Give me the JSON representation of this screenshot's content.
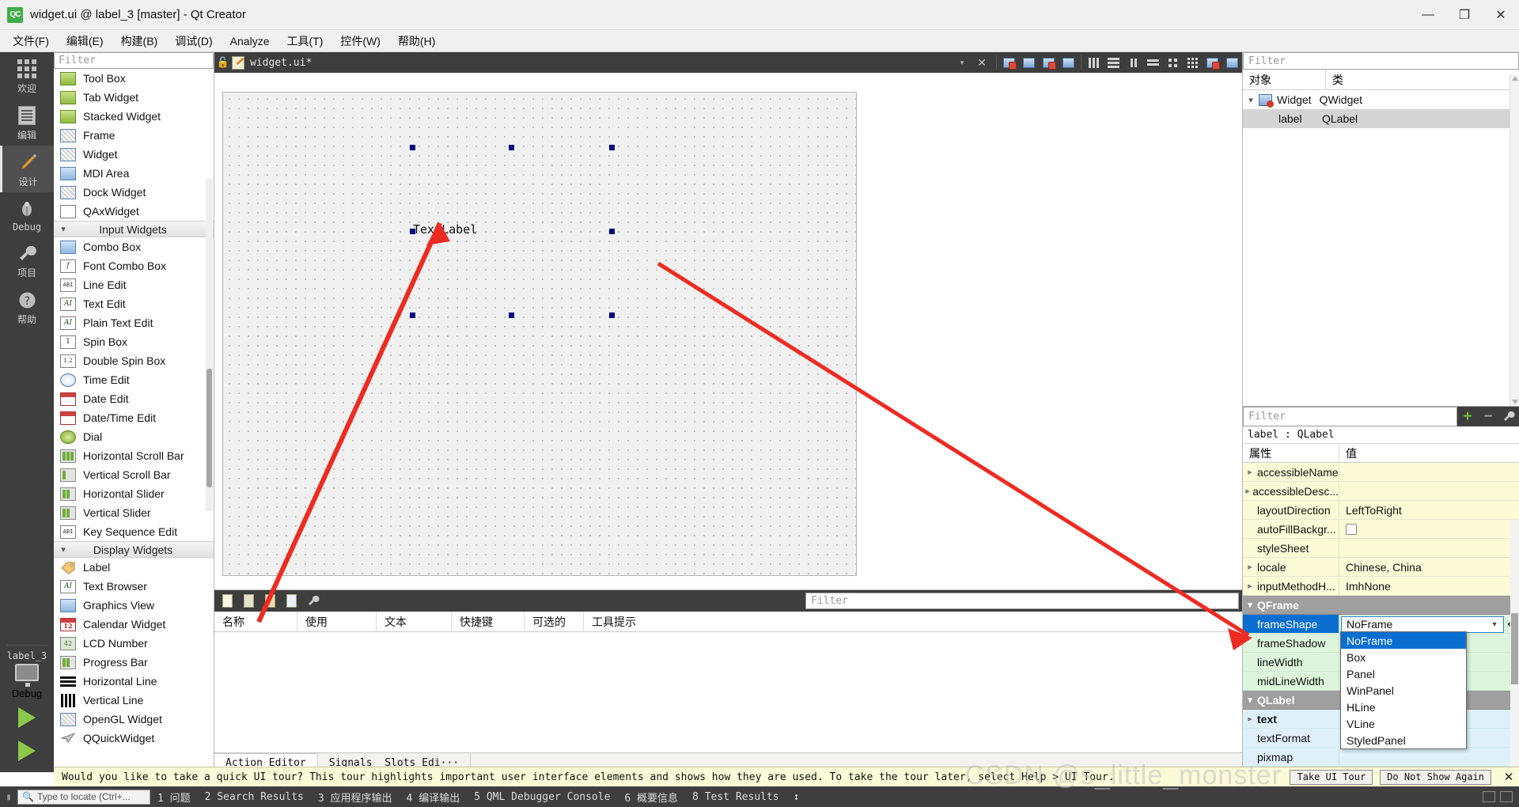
{
  "window": {
    "title": "widget.ui @ label_3 [master] - Qt Creator",
    "app_badge": "QC",
    "minimize": "—",
    "restore": "❐",
    "close": "✕"
  },
  "menubar": {
    "items": [
      {
        "label": "文件(F)"
      },
      {
        "label": "编辑(E)"
      },
      {
        "label": "构建(B)"
      },
      {
        "label": "调试(D)"
      },
      {
        "label": "Analyze"
      },
      {
        "label": "工具(T)"
      },
      {
        "label": "控件(W)"
      },
      {
        "label": "帮助(H)"
      }
    ]
  },
  "activity_bar": {
    "items": [
      {
        "label": "欢迎",
        "icon": "grid-icon",
        "selected": false
      },
      {
        "label": "编辑",
        "icon": "document-icon",
        "selected": false
      },
      {
        "label": "设计",
        "icon": "pencil-icon",
        "selected": true
      },
      {
        "label": "Debug",
        "icon": "bug-icon",
        "selected": false
      },
      {
        "label": "项目",
        "icon": "wrench-icon",
        "selected": false
      },
      {
        "label": "帮助",
        "icon": "question-icon",
        "selected": false
      }
    ],
    "kit_name": "label_3",
    "run_config_label": "Debug"
  },
  "widget_box": {
    "filter_placeholder": "Filter",
    "items": [
      {
        "label": "Tool Box",
        "icon": "toolbox-icon",
        "style": "green"
      },
      {
        "label": "Tab Widget",
        "icon": "tabwidget-icon",
        "style": "green"
      },
      {
        "label": "Stacked Widget",
        "icon": "stackedwidget-icon",
        "style": "green"
      },
      {
        "label": "Frame",
        "icon": "frame-icon",
        "style": "hatch"
      },
      {
        "label": "Widget",
        "icon": "widget-icon",
        "style": "hatch"
      },
      {
        "label": "MDI Area",
        "icon": "mdiarea-icon",
        "style": "blue"
      },
      {
        "label": "Dock Widget",
        "icon": "dockwidget-icon",
        "style": "hatch"
      },
      {
        "label": "QAxWidget",
        "icon": "qaxwidget-icon",
        "style": "white"
      },
      {
        "label": "Input Widgets",
        "icon": "chevron-down-icon",
        "style": "category"
      },
      {
        "label": "Combo Box",
        "icon": "combobox-icon",
        "style": "blue"
      },
      {
        "label": "Font Combo Box",
        "icon": "fontcombobox-icon",
        "style": "white"
      },
      {
        "label": "Line Edit",
        "icon": "lineedit-icon",
        "style": "white"
      },
      {
        "label": "Text Edit",
        "icon": "textedit-icon",
        "style": "white"
      },
      {
        "label": "Plain Text Edit",
        "icon": "plaintextedit-icon",
        "style": "white"
      },
      {
        "label": "Spin Box",
        "icon": "spinbox-icon",
        "style": "white"
      },
      {
        "label": "Double Spin Box",
        "icon": "doublespinbox-icon",
        "style": "white"
      },
      {
        "label": "Time Edit",
        "icon": "timeedit-icon",
        "style": "clock"
      },
      {
        "label": "Date Edit",
        "icon": "dateedit-icon",
        "style": "cal"
      },
      {
        "label": "Date/Time Edit",
        "icon": "datetimeedit-icon",
        "style": "cal"
      },
      {
        "label": "Dial",
        "icon": "dial-icon",
        "style": "dial"
      },
      {
        "label": "Horizontal Scroll Bar",
        "icon": "hscrollbar-icon",
        "style": "progress"
      },
      {
        "label": "Vertical Scroll Bar",
        "icon": "vscrollbar-icon",
        "style": "progress"
      },
      {
        "label": "Horizontal Slider",
        "icon": "hslider-icon",
        "style": "progress"
      },
      {
        "label": "Vertical Slider",
        "icon": "vslider-icon",
        "style": "progress"
      },
      {
        "label": "Key Sequence Edit",
        "icon": "keysequenceedit-icon",
        "style": "white"
      },
      {
        "label": "Display Widgets",
        "icon": "chevron-down-icon",
        "style": "category"
      },
      {
        "label": "Label",
        "icon": "label-icon",
        "style": "label-tag"
      },
      {
        "label": "Text Browser",
        "icon": "textbrowser-icon",
        "style": "white"
      },
      {
        "label": "Graphics View",
        "icon": "graphicsview-icon",
        "style": "blue"
      },
      {
        "label": "Calendar Widget",
        "icon": "calendarwidget-icon",
        "style": "cal"
      },
      {
        "label": "LCD Number",
        "icon": "lcdnumber-icon",
        "style": "lcd"
      },
      {
        "label": "Progress Bar",
        "icon": "progressbar-icon",
        "style": "progress"
      },
      {
        "label": "Horizontal Line",
        "icon": "hline-icon",
        "style": "hbars"
      },
      {
        "label": "Vertical Line",
        "icon": "vline-icon",
        "style": "vbars"
      },
      {
        "label": "OpenGL Widget",
        "icon": "openglwidget-icon",
        "style": "hatch"
      },
      {
        "label": "QQuickWidget",
        "icon": "qquickwidget-icon",
        "style": "white"
      }
    ]
  },
  "designer": {
    "toolbar": {
      "file_name": "widget.ui*",
      "lock_icon": "unlocked-icon",
      "dropdown_icon": "chevron-down-icon",
      "close_icon": "close-icon",
      "buttons": [
        {
          "icon": "edit-widgets-icon"
        },
        {
          "icon": "edit-signals-slots-icon"
        },
        {
          "icon": "edit-buddies-icon"
        },
        {
          "icon": "edit-tab-order-icon"
        },
        {
          "icon": "layout-horizontally-icon"
        },
        {
          "icon": "layout-vertically-icon"
        },
        {
          "icon": "layout-splitter-horizontal-icon"
        },
        {
          "icon": "layout-splitter-vertical-icon"
        },
        {
          "icon": "layout-form-icon"
        },
        {
          "icon": "layout-grid-icon"
        },
        {
          "icon": "break-layout-icon"
        },
        {
          "icon": "adjust-size-icon"
        }
      ]
    },
    "canvas": {
      "label_text": "TextLabel",
      "selection_handle_color": "#00007f",
      "form_background": "#f0f0f0"
    }
  },
  "action_editor": {
    "toolbar_buttons": [
      {
        "icon": "new-action-icon"
      },
      {
        "icon": "copy-action-icon"
      },
      {
        "icon": "edit-action-icon"
      },
      {
        "icon": "delete-action-icon"
      },
      {
        "icon": "configure-icon"
      }
    ],
    "filter_placeholder": "Filter",
    "columns": [
      "名称",
      "使用",
      "文本",
      "快捷键",
      "可选的",
      "工具提示"
    ],
    "rows": [],
    "tabs": [
      {
        "label": "Action Editor",
        "selected": true
      },
      {
        "label": "Signals _Slots Edi···",
        "selected": false
      }
    ]
  },
  "object_inspector": {
    "filter_placeholder": "Filter",
    "columns": [
      "对象",
      "类"
    ],
    "rows": [
      {
        "object": "Widget",
        "class": "QWidget",
        "depth": 0,
        "expanded": true,
        "selected": false,
        "icon": "qwidget-icon"
      },
      {
        "object": "label",
        "class": "QLabel",
        "depth": 1,
        "expanded": false,
        "selected": true,
        "icon": null
      }
    ]
  },
  "property_editor": {
    "filter_placeholder": "Filter",
    "add_button_icon": "plus-icon",
    "remove_button_icon": "minus-icon",
    "configure_button_icon": "wrench-icon",
    "object_header": "label : QLabel",
    "columns": [
      "属性",
      "值"
    ],
    "rows": [
      {
        "name": "accessibleName",
        "value": "",
        "group": null,
        "expandable": true,
        "color": "yellow"
      },
      {
        "name": "accessibleDesc...",
        "value": "",
        "group": null,
        "expandable": true,
        "color": "yellow"
      },
      {
        "name": "layoutDirection",
        "value": "LeftToRight",
        "group": null,
        "expandable": false,
        "color": "yellow"
      },
      {
        "name": "autoFillBackgr...",
        "value": "",
        "group": null,
        "expandable": false,
        "color": "yellow",
        "control": "checkbox",
        "checked": false
      },
      {
        "name": "styleSheet",
        "value": "",
        "group": null,
        "expandable": false,
        "color": "yellow"
      },
      {
        "name": "locale",
        "value": "Chinese, China",
        "group": null,
        "expandable": true,
        "color": "yellow"
      },
      {
        "name": "inputMethodH...",
        "value": "ImhNone",
        "group": null,
        "expandable": true,
        "color": "yellow"
      },
      {
        "name": "QFrame",
        "value": "",
        "group": true,
        "expandable": true,
        "color": "group"
      },
      {
        "name": "frameShape",
        "value": "NoFrame",
        "group": null,
        "expandable": false,
        "color": "green",
        "selected": true,
        "control": "combobox"
      },
      {
        "name": "frameShadow",
        "value": "",
        "group": null,
        "expandable": false,
        "color": "green"
      },
      {
        "name": "lineWidth",
        "value": "",
        "group": null,
        "expandable": false,
        "color": "green"
      },
      {
        "name": "midLineWidth",
        "value": "",
        "group": null,
        "expandable": false,
        "color": "green"
      },
      {
        "name": "QLabel",
        "value": "",
        "group": true,
        "expandable": true,
        "color": "group"
      },
      {
        "name": "text",
        "value": "",
        "group": null,
        "expandable": true,
        "color": "blue",
        "bold": true
      },
      {
        "name": "textFormat",
        "value": "",
        "group": null,
        "expandable": false,
        "color": "blue"
      },
      {
        "name": "pixmap",
        "value": "",
        "group": null,
        "expandable": false,
        "color": "blue"
      }
    ],
    "dropdown": {
      "open": true,
      "selected": "NoFrame",
      "options": [
        "NoFrame",
        "Box",
        "Panel",
        "WinPanel",
        "HLine",
        "VLine",
        "StyledPanel"
      ]
    }
  },
  "tour_banner": {
    "message": "Would you like to take a quick UI tour? This tour highlights important user interface elements and shows how they are used. To take the tour later, select Help > UI Tour.",
    "primary_button": "Take UI Tour",
    "secondary_button": "Do Not Show Again",
    "close_icon": "close-icon"
  },
  "status_bar": {
    "locate_placeholder": "Type to locate (Ctrl+...",
    "search_icon": "search-icon",
    "items": [
      "1 问题",
      "2 Search Results",
      "3 应用程序输出",
      "4 编译输出",
      "5 QML Debugger Console",
      "6 概要信息",
      "8 Test Results"
    ],
    "updown_icon": "updown-icon"
  },
  "watermark": "CSDN @s_little_monster",
  "colors": {
    "accent": "#0a6ed1",
    "dark_chrome": "#3e3e3e",
    "annotation_arrow": "#ee2b22",
    "handle": "#00007f",
    "property_yellow": "#fbfbd8",
    "property_green": "#ddf5dd",
    "property_blue": "#dff0fa"
  }
}
